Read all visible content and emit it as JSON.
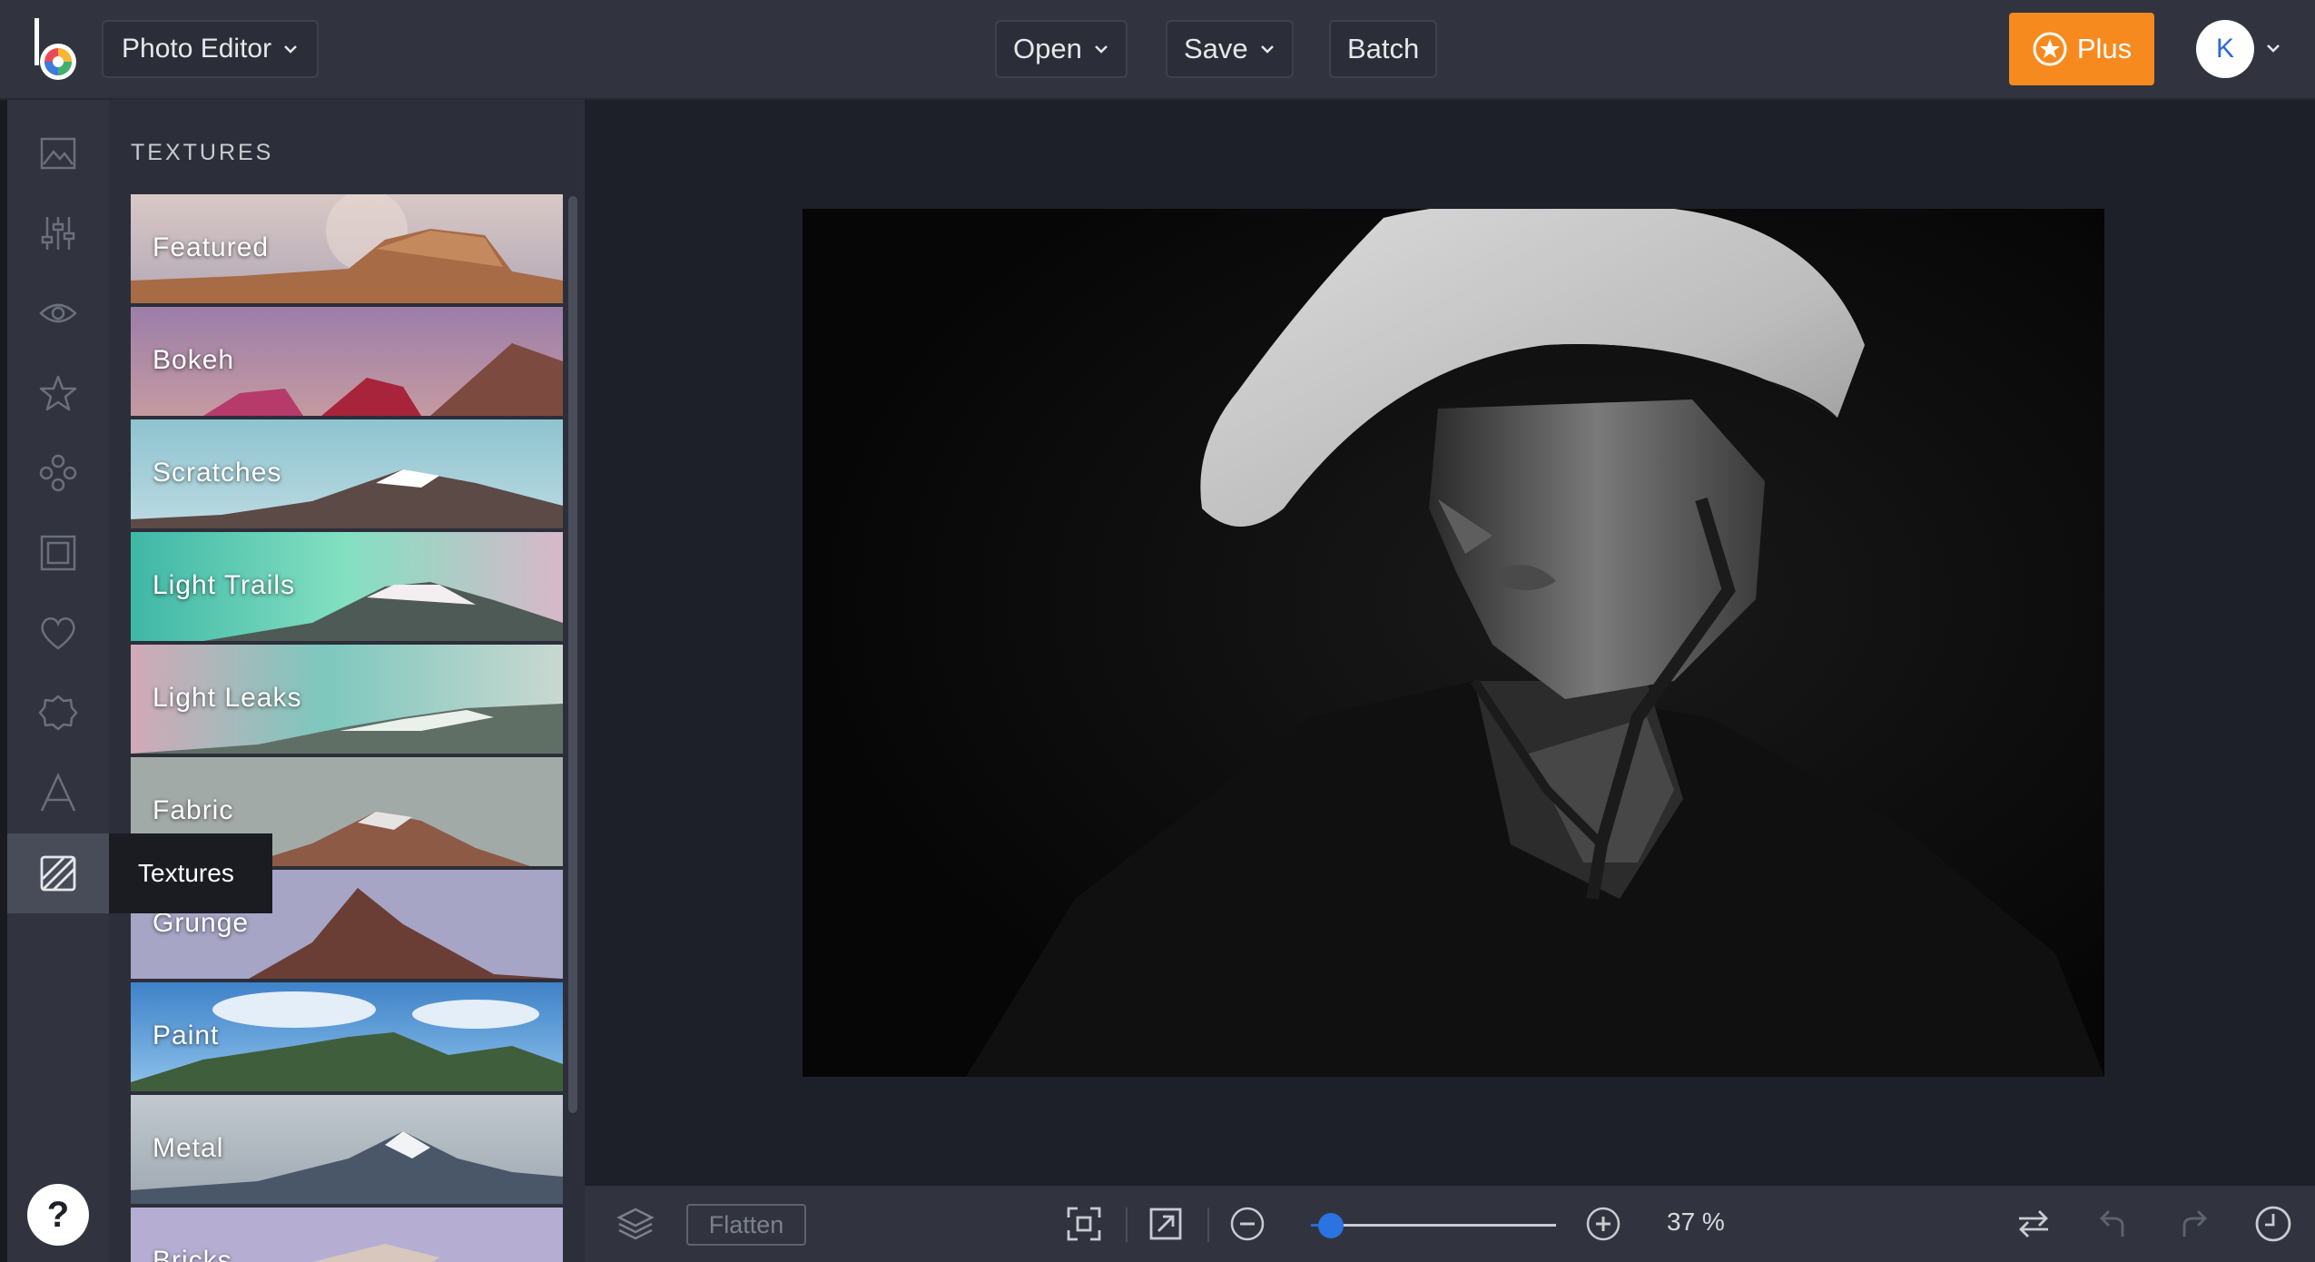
{
  "header": {
    "app_menu_label": "Photo Editor",
    "open_label": "Open",
    "save_label": "Save",
    "batch_label": "Batch",
    "plus_label": "Plus",
    "avatar_initial": "K"
  },
  "rail": {
    "items": [
      {
        "name": "edit-image-icon"
      },
      {
        "name": "adjust-sliders-icon"
      },
      {
        "name": "eye-icon"
      },
      {
        "name": "star-icon"
      },
      {
        "name": "graphics-icon"
      },
      {
        "name": "frame-icon"
      },
      {
        "name": "heart-icon"
      },
      {
        "name": "badge-icon"
      },
      {
        "name": "text-icon"
      },
      {
        "name": "textures-icon"
      }
    ],
    "tooltip": "Textures",
    "help_label": "?"
  },
  "panel": {
    "title": "TEXTURES",
    "items": [
      {
        "label": "Featured"
      },
      {
        "label": "Bokeh"
      },
      {
        "label": "Scratches"
      },
      {
        "label": "Light Trails"
      },
      {
        "label": "Light Leaks"
      },
      {
        "label": "Fabric"
      },
      {
        "label": "Grunge"
      },
      {
        "label": "Paint"
      },
      {
        "label": "Metal"
      },
      {
        "label": "Bricks"
      }
    ]
  },
  "bottombar": {
    "flatten_label": "Flatten",
    "zoom_value": "37 %",
    "zoom_fraction": 0.08
  },
  "colors": {
    "accent": "#f78a1e",
    "slider": "#2a73e0",
    "topbar": "#31343f",
    "canvas": "#1e2029"
  }
}
